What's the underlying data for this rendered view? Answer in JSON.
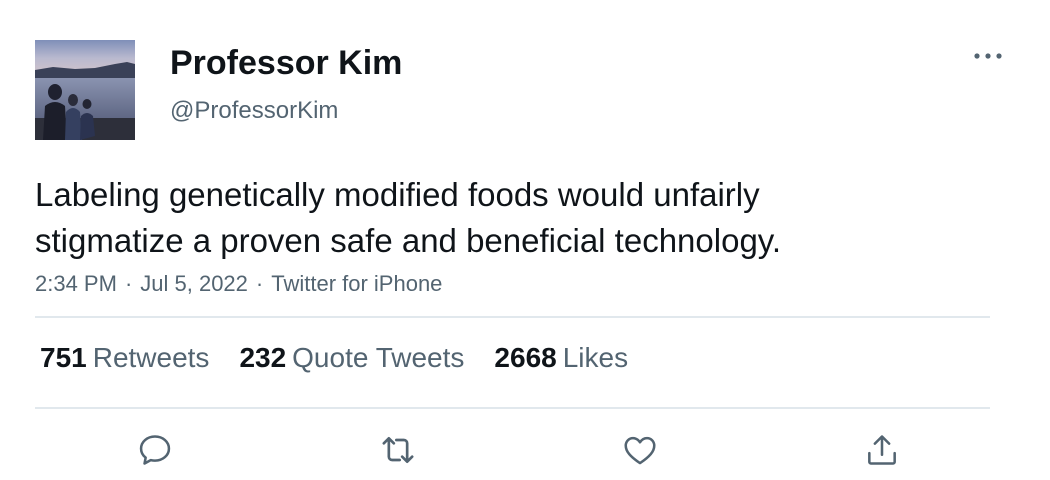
{
  "tweet": {
    "author": {
      "display_name": "Professor Kim",
      "handle": "@ProfessorKim",
      "avatar_icon": "avatar-lake-family-photo"
    },
    "text_lines": [
      "Labeling genetically modified foods would unfairly",
      "stigmatize a proven safe and beneficial technology."
    ],
    "time": "2:34 PM",
    "date": "Jul 5, 2022",
    "source": "Twitter for iPhone",
    "separator": "·",
    "stats": {
      "retweets": {
        "count": "751",
        "label": "Retweets"
      },
      "quote_tweets": {
        "count": "232",
        "label": "Quote Tweets"
      },
      "likes": {
        "count": "2668",
        "label": "Likes"
      }
    },
    "actions": [
      "reply-icon",
      "retweet-icon",
      "like-icon",
      "share-icon"
    ]
  },
  "colors": {
    "text_primary": "#0f1419",
    "text_secondary": "#536471",
    "divider": "#e1e8ed",
    "icon": "#536471"
  }
}
